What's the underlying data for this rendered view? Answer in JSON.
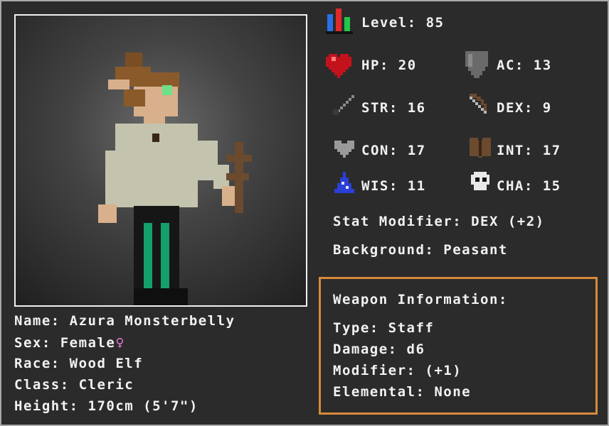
{
  "stats": {
    "level": {
      "label": "Level:",
      "value": "85"
    },
    "hp": {
      "label": "HP:",
      "value": "20"
    },
    "ac": {
      "label": "AC:",
      "value": "13"
    },
    "str": {
      "label": "STR:",
      "value": "16"
    },
    "dex": {
      "label": "DEX:",
      "value": "9"
    },
    "con": {
      "label": "CON:",
      "value": "17"
    },
    "int": {
      "label": "INT:",
      "value": "17"
    },
    "wis": {
      "label": "WIS:",
      "value": "11"
    },
    "cha": {
      "label": "CHA:",
      "value": "15"
    }
  },
  "stat_modifier": "Stat Modifier: DEX (+2)",
  "background": "Background: Peasant",
  "character": {
    "name": "Name: Azura Monsterbelly",
    "sex": "Sex: Female",
    "sex_symbol": "♀",
    "race": "Race: Wood Elf",
    "class": "Class: Cleric",
    "height": "Height: 170cm (5'7\")"
  },
  "weapon": {
    "heading": "Weapon Information:",
    "type": "Type: Staff",
    "damage": "Damage: d6",
    "modifier": "Modifier: (+1)",
    "elemental": "Elemental: None"
  },
  "icons": {
    "level": "level-bars-icon",
    "hp": "heart-icon",
    "ac": "shield-icon",
    "str": "sword-icon",
    "dex": "bow-icon",
    "con": "grey-heart-icon",
    "int": "book-icon",
    "wis": "wizard-hat-icon",
    "cha": "skull-icon"
  },
  "colors": {
    "frame": "#a8a8a8",
    "panel": "#2b2b2b",
    "text": "#f2f2f2",
    "weapon_border": "#d88a3a",
    "female_symbol": "#e07ad8"
  }
}
